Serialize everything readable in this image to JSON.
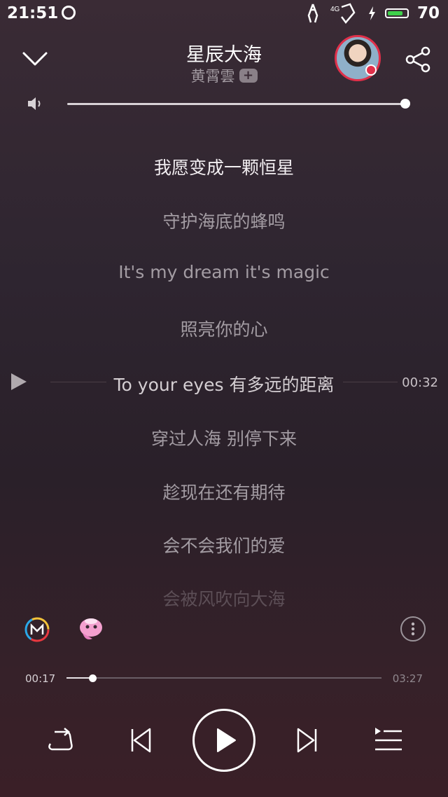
{
  "status": {
    "time": "21:51",
    "battery": "70",
    "network": "4G"
  },
  "header": {
    "title": "星辰大海",
    "artist": "黄霄雲",
    "add_label": "+"
  },
  "volume": {
    "level": 1.0
  },
  "lyrics": [
    {
      "text": "我愿变成一颗恒星"
    },
    {
      "text": "守护海底的蜂鸣"
    },
    {
      "text": "It's my dream it's magic"
    },
    {
      "text": "照亮你的心"
    },
    {
      "text": "To your eyes 有多远的距离"
    },
    {
      "text": "穿过人海 别停下来"
    },
    {
      "text": "趁现在还有期待"
    },
    {
      "text": "会不会我们的爱"
    },
    {
      "text": "会被风吹向大海"
    }
  ],
  "lyric_seek_time": "00:32",
  "progress": {
    "current": "00:17",
    "total": "03:27",
    "fraction": 0.082
  },
  "icons": {
    "back": "chevron-down-icon",
    "share": "share-icon",
    "volume": "speaker-icon",
    "repeat": "repeat-icon",
    "prev": "skip-previous-icon",
    "play": "play-icon",
    "next": "skip-next-icon",
    "playlist": "playlist-icon",
    "more": "more-vertical-icon"
  },
  "colors": {
    "accent": "#e0304a",
    "text_active": "#f2eef1",
    "text_dim": "#a39ca3"
  }
}
